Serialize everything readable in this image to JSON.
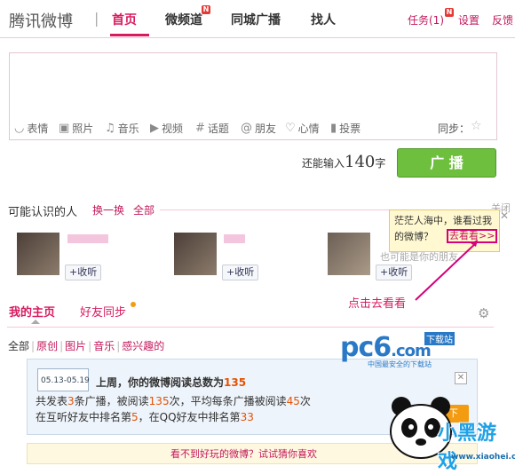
{
  "header": {
    "brand": "腾讯微博",
    "sep": "|",
    "nav": {
      "home": "首页",
      "video": "微频道",
      "city": "同城广播",
      "find": "找人"
    },
    "badge": "N",
    "tasks": "任务(1)",
    "settings": "设置",
    "feedback": "反馈"
  },
  "composer": {
    "tools": [
      {
        "icon": "smile-icon",
        "glyph": "◡",
        "label": "表情"
      },
      {
        "icon": "photo-icon",
        "glyph": "▣",
        "label": "照片"
      },
      {
        "icon": "music-icon",
        "glyph": "♫",
        "label": "音乐"
      },
      {
        "icon": "video-icon",
        "glyph": "▶",
        "label": "视频"
      },
      {
        "icon": "hash-icon",
        "glyph": "#",
        "label": "话题"
      },
      {
        "icon": "at-icon",
        "glyph": "@",
        "label": "朋友"
      },
      {
        "icon": "heart-icon",
        "glyph": "♡",
        "label": "心情"
      },
      {
        "icon": "poll-icon",
        "glyph": "▮",
        "label": "投票"
      }
    ],
    "sync": "同步：",
    "remain_prefix": "还能输入",
    "remain_num": "140",
    "remain_suffix": "字",
    "post": "广 播"
  },
  "pymk": {
    "title": "可能认识的人",
    "refresh": "换一换",
    "all": "全部",
    "close": "关闭",
    "follow": "+收听",
    "dim_text": "也可能是你的朋友"
  },
  "popup": {
    "text": "茫茫人海中，谁看过我的微博？",
    "link": "去看看>>",
    "close": "✕",
    "note": "点击去看看"
  },
  "tabs": {
    "home": "我的主页",
    "sync": "好友同步"
  },
  "filters": [
    "全部",
    "原创",
    "图片",
    "音乐",
    "感兴趣的"
  ],
  "watermark": {
    "pc6": "pc6",
    "com": ".com",
    "tag": "下载站",
    "sub": "中国最安全的下载站"
  },
  "report": {
    "date": "05.13-05.19",
    "title_a": "上周，你的微博阅读总数为",
    "title_num": "135",
    "l1_a": "共发表",
    "l1_n1": "3",
    "l1_b": "条广播，被阅读",
    "l1_n2": "135",
    "l1_c": "次，平均每条广播被阅读",
    "l1_n3": "45",
    "l1_d": "次",
    "l2_a": "在互听好友中排名第",
    "l2_n1": "5",
    "l2_b": "，在QQ好友中排名第",
    "l2_n2": "33",
    "close": "✕",
    "btn": "炫耀一下"
  },
  "bottom": "看不到好玩的微博？试试猜你喜欢",
  "logo": {
    "brand": "小黑游戏",
    "url": "www.xiaohei.com"
  }
}
